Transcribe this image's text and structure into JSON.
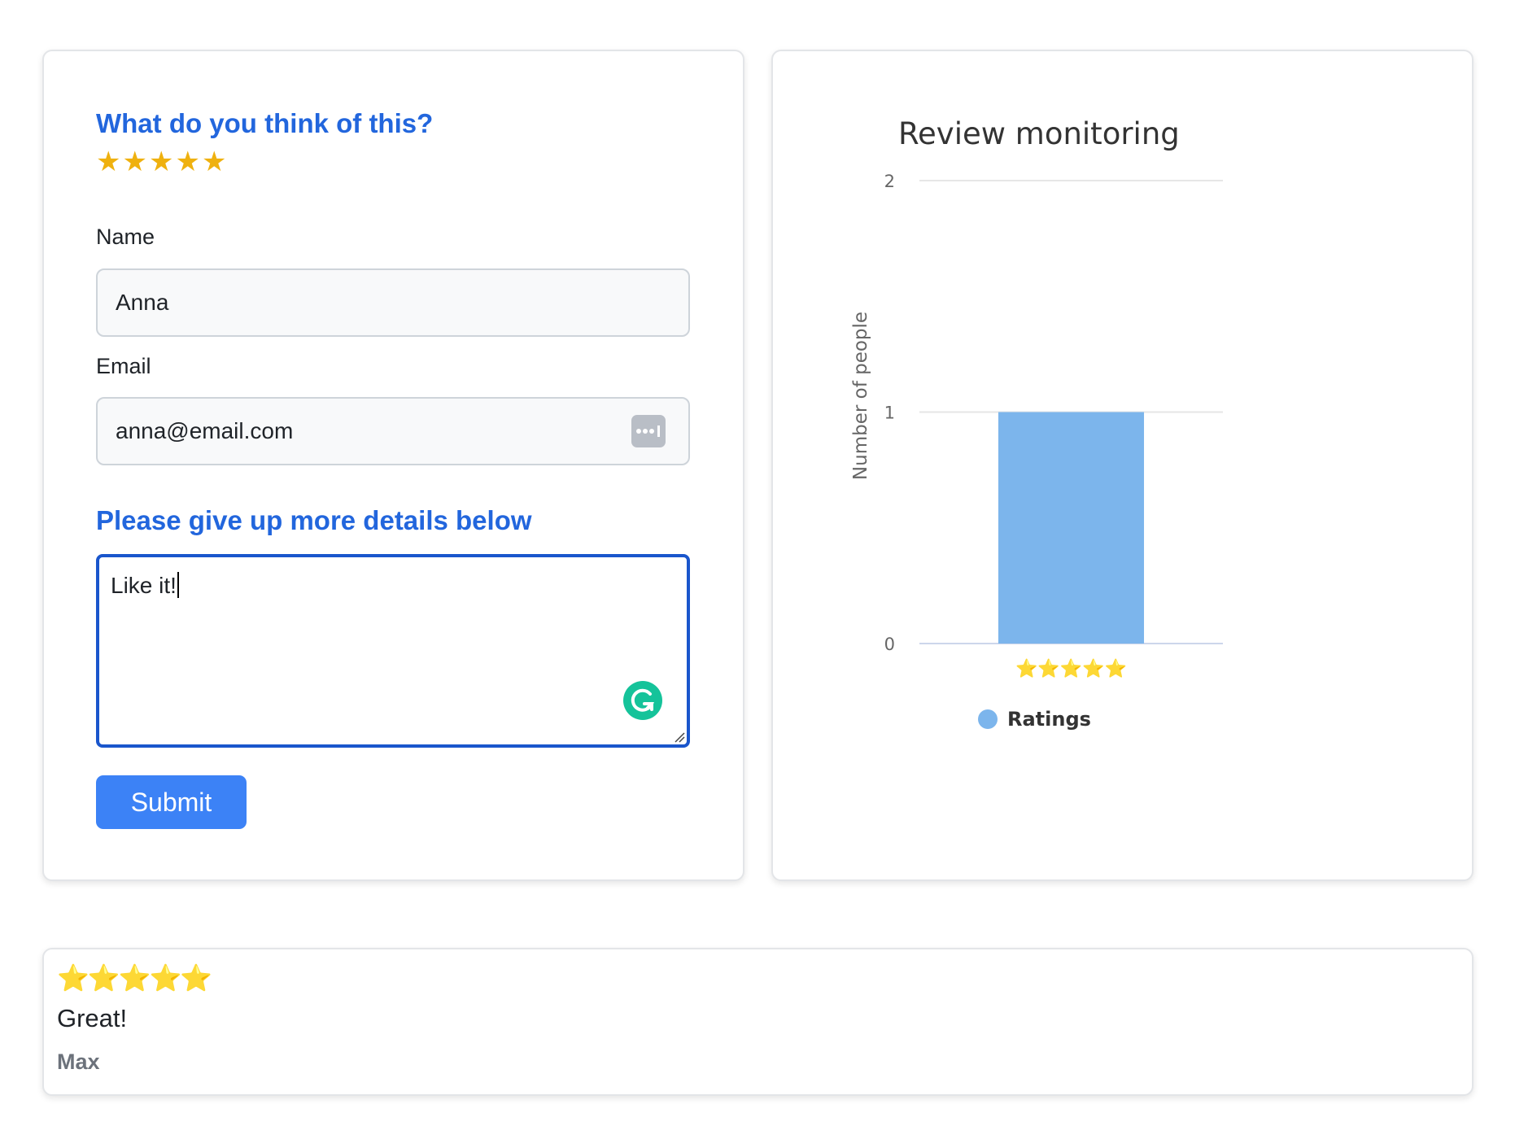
{
  "form": {
    "question": "What do you think of this?",
    "rating": 5,
    "star_glyph": "★",
    "name_label": "Name",
    "name_value": "Anna",
    "email_label": "Email",
    "email_value": "anna@email.com",
    "details_heading": "Please give up more details below",
    "details_value": "Like it!",
    "submit_label": "Submit",
    "accent_color": "#2266dd",
    "star_color": "#efb10f",
    "button_color": "#3c82f6"
  },
  "chart": {
    "title": "Review monitoring",
    "legend_label": "Ratings"
  },
  "chart_data": {
    "type": "bar",
    "title": "Review monitoring",
    "categories": [
      "⭐⭐⭐⭐⭐"
    ],
    "series": [
      {
        "name": "Ratings",
        "values": [
          1
        ],
        "color": "#7cb5ec"
      }
    ],
    "xlabel": "",
    "ylabel": "Number of people",
    "ylim": [
      0,
      2
    ],
    "yticks": [
      0,
      1,
      2
    ],
    "grid": true,
    "legend_position": "bottom"
  },
  "review": {
    "stars": "⭐⭐⭐⭐⭐",
    "text": "Great!",
    "author": "Max"
  }
}
